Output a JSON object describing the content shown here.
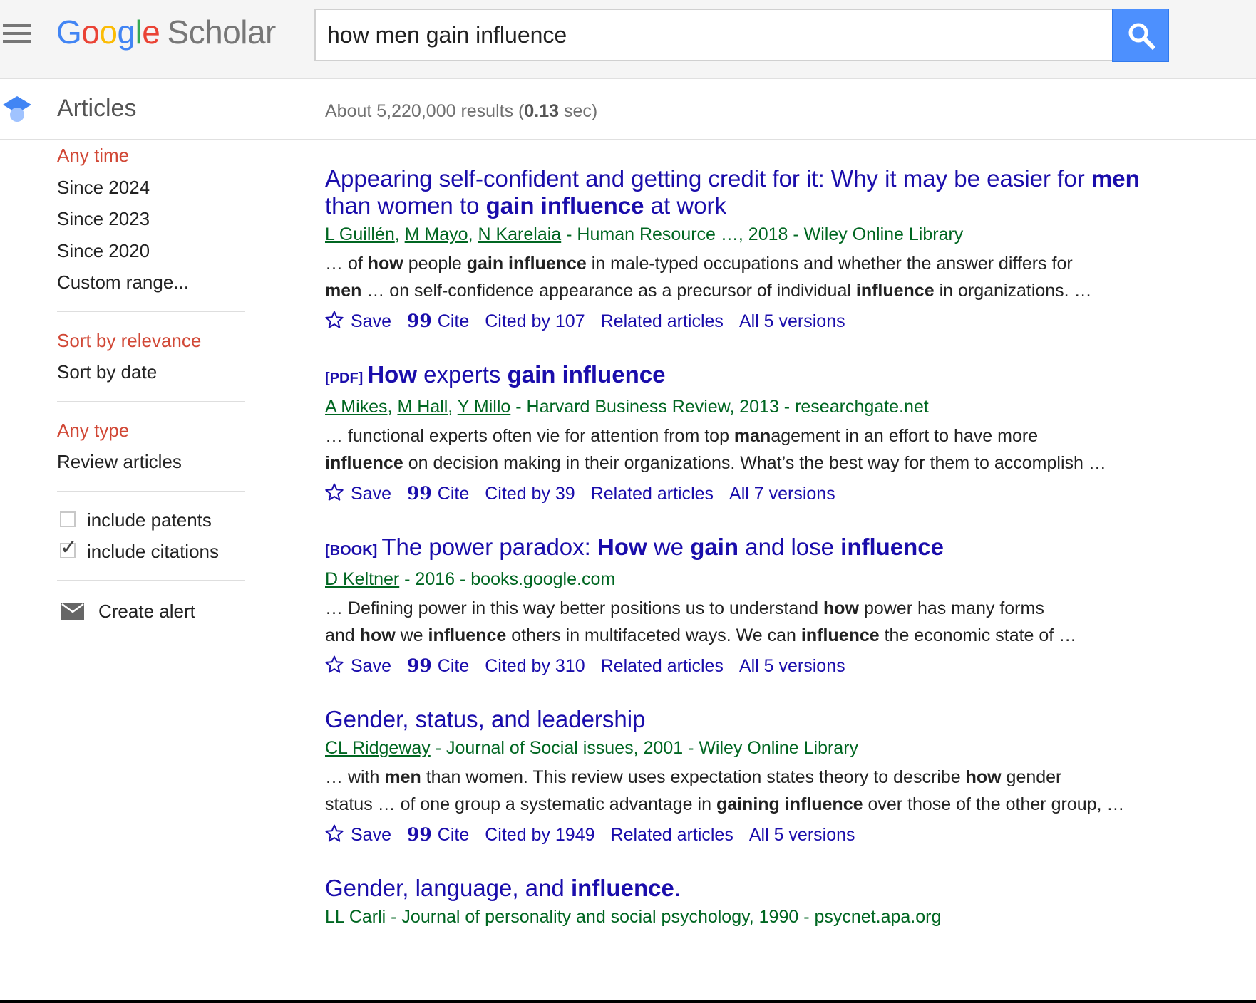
{
  "header": {
    "logo": {
      "g1": "G",
      "o1": "o",
      "o2": "o",
      "g2": "g",
      "l": "l",
      "e": "e",
      "scholar": "Scholar"
    },
    "search_value": "how men gain influence"
  },
  "subbar": {
    "section_label": "Articles",
    "stats_prefix": "About 5,220,000 results (",
    "stats_time": "0.13",
    "stats_suffix": " sec)"
  },
  "sidebar": {
    "time": [
      "Any time",
      "Since 2024",
      "Since 2023",
      "Since 2020",
      "Custom range..."
    ],
    "sort": [
      "Sort by relevance",
      "Sort by date"
    ],
    "type": [
      "Any type",
      "Review articles"
    ],
    "include_patents": {
      "label": "include patents",
      "checked": false
    },
    "include_citations": {
      "label": "include citations",
      "checked": true
    },
    "create_alert": "Create alert"
  },
  "results": [
    {
      "tag": "",
      "title": [
        [
          "n",
          "Appearing self-confident and getting credit for it: Why it may be easier for "
        ],
        [
          "b",
          "men"
        ],
        [
          "n",
          " than women to "
        ],
        [
          "b",
          "gain influence"
        ],
        [
          "n",
          " at work"
        ]
      ],
      "authors": [
        "L Guillén",
        "M Mayo",
        "N Karelaia"
      ],
      "meta_rest": " - Human Resource …, 2018 - Wiley Online Library",
      "snippet1": [
        [
          "n",
          "… of "
        ],
        [
          "b",
          "how"
        ],
        [
          "n",
          " people "
        ],
        [
          "b",
          "gain influence"
        ],
        [
          "n",
          " in male-typed occupations and whether the answer differs for"
        ]
      ],
      "snippet2": [
        [
          "b",
          "men"
        ],
        [
          "n",
          " … on self-confidence appearance as a precursor of individual "
        ],
        [
          "b",
          "influence"
        ],
        [
          "n",
          " in organizations. …"
        ]
      ],
      "actions": {
        "save": "Save",
        "cite": "Cite",
        "cited_by": "Cited by 107",
        "related": "Related articles",
        "versions": "All 5 versions"
      }
    },
    {
      "tag": "[PDF]",
      "title": [
        [
          "b",
          "How"
        ],
        [
          "n",
          " experts "
        ],
        [
          "b",
          "gain influence"
        ]
      ],
      "authors": [
        "A Mikes",
        "M Hall",
        "Y Millo"
      ],
      "meta_rest": " - Harvard Business Review, 2013 - researchgate.net",
      "snippet1": [
        [
          "n",
          "… functional experts often vie for attention from top "
        ],
        [
          "b",
          "man"
        ],
        [
          "n",
          "agement in an effort to have more"
        ]
      ],
      "snippet2": [
        [
          "b",
          "influence"
        ],
        [
          "n",
          " on decision making in their organizations. What’s the best way for them to accomplish …"
        ]
      ],
      "actions": {
        "save": "Save",
        "cite": "Cite",
        "cited_by": "Cited by 39",
        "related": "Related articles",
        "versions": "All 7 versions"
      }
    },
    {
      "tag": "[BOOK]",
      "title": [
        [
          "n",
          "The power paradox: "
        ],
        [
          "b",
          "How"
        ],
        [
          "n",
          " we "
        ],
        [
          "b",
          "gain"
        ],
        [
          "n",
          " and lose "
        ],
        [
          "b",
          "influence"
        ]
      ],
      "authors": [
        "D Keltner"
      ],
      "meta_rest": " - 2016 - books.google.com",
      "snippet1": [
        [
          "n",
          "… Defining power in this way better positions us to understand "
        ],
        [
          "b",
          "how"
        ],
        [
          "n",
          " power has many forms"
        ]
      ],
      "snippet2": [
        [
          "n",
          "and "
        ],
        [
          "b",
          "how"
        ],
        [
          "n",
          " we "
        ],
        [
          "b",
          "influence"
        ],
        [
          "n",
          " others in multifaceted ways. We can "
        ],
        [
          "b",
          "influence"
        ],
        [
          "n",
          " the economic state of …"
        ]
      ],
      "actions": {
        "save": "Save",
        "cite": "Cite",
        "cited_by": "Cited by 310",
        "related": "Related articles",
        "versions": "All 5 versions"
      }
    },
    {
      "tag": "",
      "title": [
        [
          "n",
          "Gender, status, and leadership"
        ]
      ],
      "authors": [
        "CL Ridgeway"
      ],
      "meta_rest": " - Journal of Social issues, 2001 - Wiley Online Library",
      "snippet1": [
        [
          "n",
          "… with "
        ],
        [
          "b",
          "men"
        ],
        [
          "n",
          " than women. This review uses expectation states theory to describe "
        ],
        [
          "b",
          "how"
        ],
        [
          "n",
          " gender"
        ]
      ],
      "snippet2": [
        [
          "n",
          "status … of one group a systematic advantage in "
        ],
        [
          "b",
          "gaining influence"
        ],
        [
          "n",
          " over those of the other group, …"
        ]
      ],
      "actions": {
        "save": "Save",
        "cite": "Cite",
        "cited_by": "Cited by 1949",
        "related": "Related articles",
        "versions": "All 5 versions"
      }
    },
    {
      "tag": "",
      "title": [
        [
          "n",
          "Gender, language, and "
        ],
        [
          "b",
          "influence"
        ],
        [
          "n",
          "."
        ]
      ],
      "authors_plain": "LL Carli",
      "meta_rest": " - Journal of personality and social psychology, 1990 - psycnet.apa.org"
    }
  ]
}
